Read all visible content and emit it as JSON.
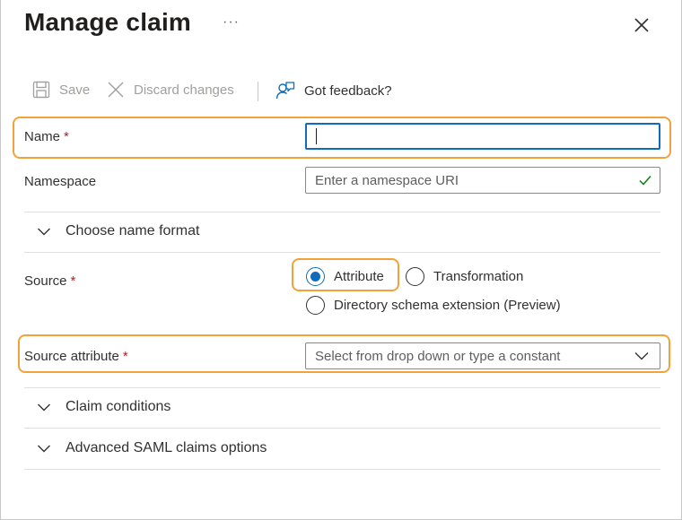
{
  "header": {
    "title": "Manage claim",
    "more_label": "···"
  },
  "toolbar": {
    "save_label": "Save",
    "discard_label": "Discard changes",
    "feedback_label": "Got feedback?"
  },
  "form": {
    "required_mark": "*",
    "name": {
      "label": "Name",
      "value": ""
    },
    "namespace": {
      "label": "Namespace",
      "placeholder": "Enter a namespace URI"
    },
    "name_format": {
      "label": "Choose name format"
    },
    "source": {
      "label": "Source",
      "options": [
        {
          "label": "Attribute",
          "selected": true
        },
        {
          "label": "Transformation",
          "selected": false
        },
        {
          "label": "Directory schema extension (Preview)",
          "selected": false
        }
      ]
    },
    "source_attribute": {
      "label": "Source attribute",
      "placeholder": "Select from drop down or type a constant"
    },
    "sections": [
      {
        "label": "Claim conditions"
      },
      {
        "label": "Advanced SAML claims options"
      }
    ]
  },
  "colors": {
    "accent": "#0f6cbd",
    "highlight": "#f5a13a",
    "required": "#a4262c",
    "valid_check": "#107c10"
  }
}
